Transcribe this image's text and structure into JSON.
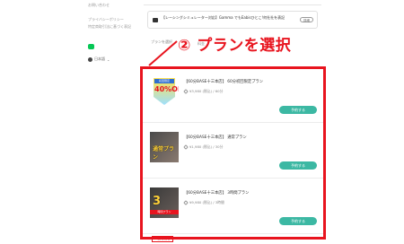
{
  "sidebar": {
    "links": [
      "お問い合わせ",
      "プライバシーポリシー",
      "特定商取引法に基づく表記"
    ],
    "language": "日本語"
  },
  "notice": {
    "text": "【レーシングシミュレーター対応】Gamma でもEabisひとこ!何社社を表記",
    "badge": "詳細"
  },
  "gray_row": [
    "プランを選択",
    "料金"
  ],
  "callout": "② プランを選択",
  "plans": [
    {
      "title": "【60分BASE十三本店】 60分初回限定プラン",
      "meta": "¥3,980 (税込) / 60分",
      "button": "予約する",
      "thumb_top": "初回限定",
      "thumb_text": "40%OFF"
    },
    {
      "title": "【60分BASE十三本店】 通常プラン",
      "meta": "¥1,980 (税込) / 30分",
      "button": "予約する",
      "thumb_text": "通常プラン"
    },
    {
      "title": "【60分BASE十三本店】 3時間プラン",
      "meta": "¥9,980 (税込) / 3時間",
      "button": "予約する",
      "thumb_text": "3",
      "thumb_bar": "時間プラン"
    }
  ],
  "more_link": "一覧を見る",
  "colors": {
    "accent_red": "#e8141e",
    "button_teal": "#3cb8a3",
    "line_green": "#06c755"
  }
}
